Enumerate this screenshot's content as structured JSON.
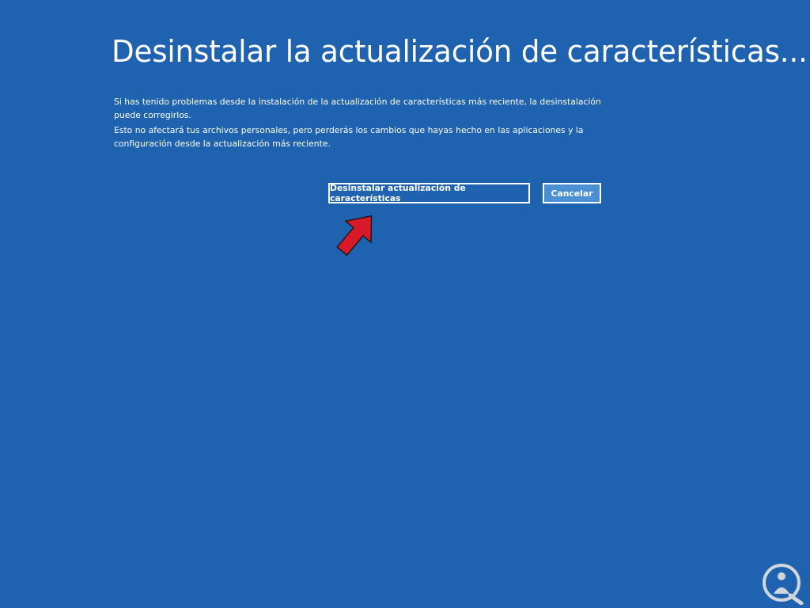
{
  "title": "Desinstalar la actualización de características...",
  "description": [
    "Si has tenido problemas desde la instalación de la actualización de características más reciente, la desinstalación puede corregirlos.",
    "Esto no afectará tus archivos personales, pero perderás los cambios que hayas hecho en las aplicaciones y la configuración desde la actualización más reciente."
  ],
  "buttons": {
    "uninstall_label": "Desinstalar actualización de características",
    "cancel_label": "Cancelar"
  },
  "annotation": {
    "arrow_icon": "red-arrow-icon",
    "arrow_color": "#d8192a"
  },
  "watermark": {
    "icon": "solvetic-logo-icon"
  },
  "colors": {
    "background": "#1f62b0",
    "secondary_button": "#4a8fd4"
  }
}
